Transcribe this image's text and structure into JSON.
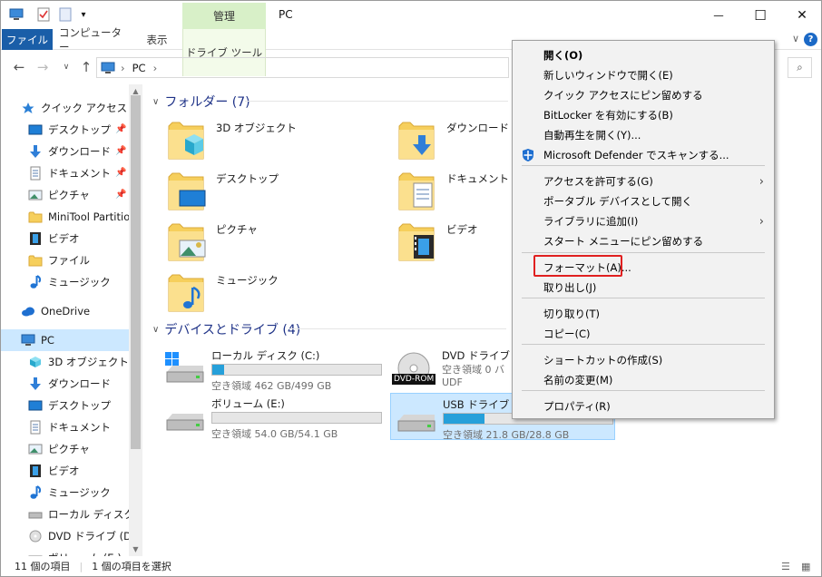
{
  "window": {
    "title": "PC",
    "manage_tab": "管理",
    "minimize": "—",
    "maximize": "☐",
    "close": "✕"
  },
  "ribbon": {
    "tabs": [
      "ファイル",
      "コンピューター",
      "表示",
      "ドライブ ツール"
    ]
  },
  "address": {
    "path_root": "PC",
    "separator": "›"
  },
  "nav": {
    "items": [
      {
        "label": "クイック アクセス",
        "icon": "star-icon"
      },
      {
        "label": "デスクトップ",
        "icon": "desktop-icon",
        "pinned": true
      },
      {
        "label": "ダウンロード",
        "icon": "download-icon",
        "pinned": true
      },
      {
        "label": "ドキュメント",
        "icon": "document-icon",
        "pinned": true
      },
      {
        "label": "ピクチャ",
        "icon": "picture-icon",
        "pinned": true
      },
      {
        "label": "MiniTool Partitio",
        "icon": "folder-icon"
      },
      {
        "label": "ビデオ",
        "icon": "video-icon"
      },
      {
        "label": "ファイル",
        "icon": "folder-icon"
      },
      {
        "label": "ミュージック",
        "icon": "music-icon"
      },
      {
        "label": "OneDrive",
        "icon": "cloud-icon"
      },
      {
        "label": "PC",
        "icon": "pc-icon",
        "selected": true
      },
      {
        "label": "3D オブジェクト",
        "icon": "cube-icon"
      },
      {
        "label": "ダウンロード",
        "icon": "download-icon"
      },
      {
        "label": "デスクトップ",
        "icon": "desktop-icon"
      },
      {
        "label": "ドキュメント",
        "icon": "document-icon"
      },
      {
        "label": "ピクチャ",
        "icon": "picture-icon"
      },
      {
        "label": "ビデオ",
        "icon": "video-icon"
      },
      {
        "label": "ミュージック",
        "icon": "music-icon"
      },
      {
        "label": "ローカル ディスク (C",
        "icon": "disk-icon"
      },
      {
        "label": "DVD ドライブ (D:)",
        "icon": "dvd-icon"
      },
      {
        "label": "ボリューム (E:)",
        "icon": "disk-icon"
      }
    ]
  },
  "folders": {
    "header": "フォルダー (7)",
    "items": [
      {
        "label": "3D オブジェクト",
        "overlay": "cube"
      },
      {
        "label": "ダウンロード",
        "overlay": "download"
      },
      {
        "label": "デスクトップ",
        "overlay": "desktop"
      },
      {
        "label": "ドキュメント",
        "overlay": "document"
      },
      {
        "label": "ピクチャ",
        "overlay": "picture"
      },
      {
        "label": "ビデオ",
        "overlay": "video"
      },
      {
        "label": "ミュージック",
        "overlay": "music"
      }
    ]
  },
  "drives": {
    "header": "デバイスとドライブ (4)",
    "items": [
      {
        "name": "ローカル ディスク (C:)",
        "free": "空き領域 462 GB/499 GB",
        "used_fraction": 0.07
      },
      {
        "name": "DVD ドライブ (D",
        "free": "空き領域 0 バ",
        "fs": "UDF",
        "badge": "DVD-ROM"
      },
      {
        "name": "ボリューム (E:)",
        "free": "空き領域 54.0 GB/54.1 GB",
        "used_fraction": 0.0
      },
      {
        "name": "USB ドライブ (F:)",
        "free": "空き領域 21.8 GB/28.8 GB",
        "used_fraction": 0.24,
        "selected": true
      }
    ]
  },
  "status": {
    "count": "11 個の項目",
    "selected": "1 個の項目を選択"
  },
  "context_menu": {
    "items": [
      {
        "label": "開く(O)",
        "bold": true
      },
      {
        "label": "新しいウィンドウで開く(E)"
      },
      {
        "label": "クイック アクセスにピン留めする"
      },
      {
        "label": "BitLocker を有効にする(B)"
      },
      {
        "label": "自動再生を開く(Y)..."
      },
      {
        "label": "Microsoft Defender でスキャンする..."
      },
      {
        "label": "アクセスを許可する(G)",
        "submenu": true
      },
      {
        "label": "ポータブル デバイスとして開く"
      },
      {
        "label": "ライブラリに追加(I)",
        "submenu": true
      },
      {
        "label": "スタート メニューにピン留めする"
      },
      {
        "label": "フォーマット(A)...",
        "highlighted": true
      },
      {
        "label": "取り出し(J)"
      },
      {
        "label": "切り取り(T)"
      },
      {
        "label": "コピー(C)"
      },
      {
        "label": "ショートカットの作成(S)"
      },
      {
        "label": "名前の変更(M)"
      },
      {
        "label": "プロパティ(R)"
      }
    ]
  },
  "colors": {
    "accent": "#1a5ea8",
    "selection": "#cce8ff",
    "folder": "#f6cf5c",
    "highlight_box": "#e02020"
  }
}
